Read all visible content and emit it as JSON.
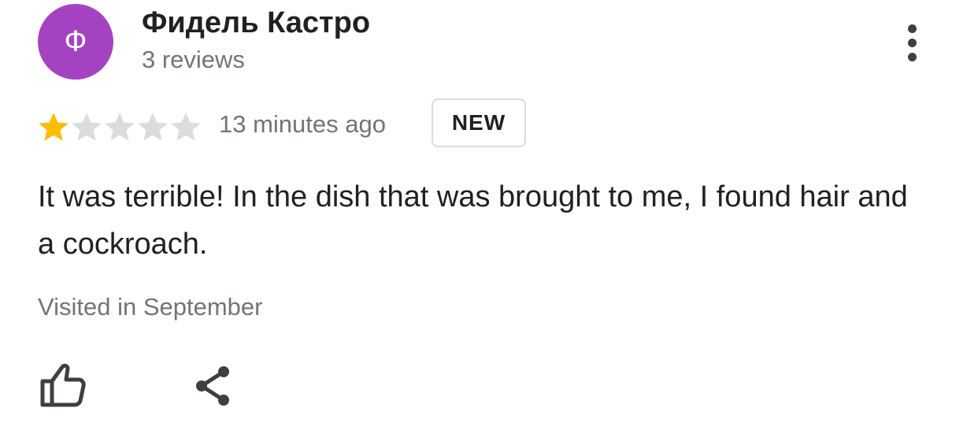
{
  "author": {
    "initial": "Ф",
    "name": "Фидель Кастро",
    "review_count": "3 reviews",
    "avatar_color": "#a443c2"
  },
  "review": {
    "rating": 1,
    "max_rating": 5,
    "star_filled_color": "#fbbc04",
    "star_empty_color": "#dadce0",
    "timestamp": "13 minutes ago",
    "badge": "NEW",
    "text": "It was terrible! In the dish that was brought to me, I found hair and a cockroach.",
    "visited": "Visited in September"
  },
  "icons": {
    "more": "more-vert-icon",
    "like": "thumb-up-icon",
    "share": "share-icon"
  }
}
